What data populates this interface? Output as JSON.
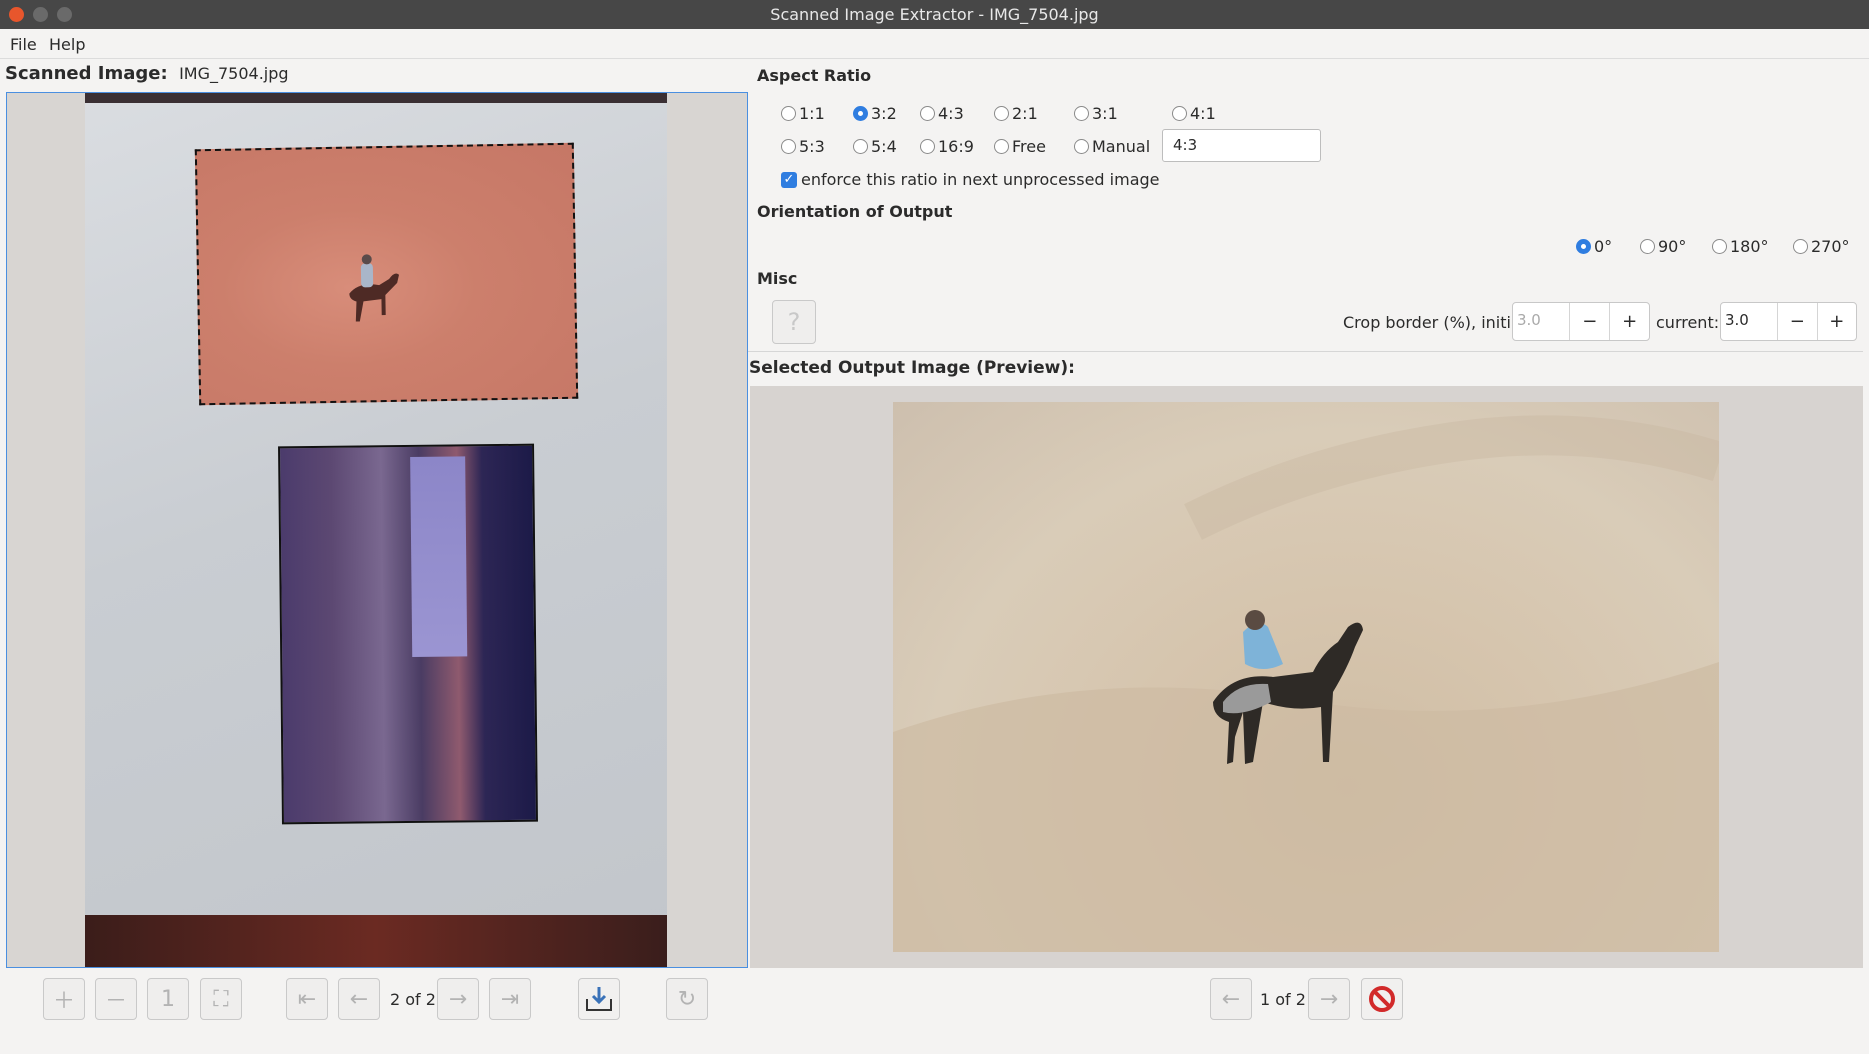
{
  "window": {
    "title": "Scanned Image Extractor - IMG_7504.jpg"
  },
  "menu": {
    "file": "File",
    "help": "Help"
  },
  "left": {
    "label": "Scanned Image:",
    "filename": "IMG_7504.jpg",
    "nav_counter": "2 of 2"
  },
  "aspect": {
    "title": "Aspect Ratio",
    "options": [
      "1:1",
      "3:2",
      "4:3",
      "2:1",
      "3:1",
      "4:1",
      "5:3",
      "5:4",
      "16:9",
      "Free",
      "Manual"
    ],
    "selected": "3:2",
    "manual_value": "4:3",
    "enforce_label": "enforce this ratio in next unprocessed image",
    "enforce_checked": true
  },
  "orientation": {
    "title": "Orientation of Output",
    "options": [
      "0°",
      "90°",
      "180°",
      "270°"
    ],
    "selected": "0°"
  },
  "misc": {
    "title": "Misc",
    "help_button": "?",
    "crop_initial_label": "Crop border (%), initial:",
    "crop_initial_value": "3.0",
    "crop_current_label": "current:",
    "crop_current_value": "3.0",
    "minus": "−",
    "plus": "+"
  },
  "preview": {
    "title": "Selected Output Image (Preview):",
    "nav_counter": "1 of 2"
  },
  "colors": {
    "accent": "#2f7de0",
    "titlebar": "#474747",
    "window_bg": "#f4f3f2"
  },
  "icons": {
    "left_toolbar": [
      "zoom-in-icon",
      "zoom-out-icon",
      "zoom-100-icon",
      "fit-to-window-icon",
      "first-icon",
      "previous-icon",
      "next-icon",
      "last-icon",
      "save-icon",
      "rotate-icon"
    ],
    "right_toolbar": [
      "previous-icon",
      "next-icon",
      "delete-icon"
    ]
  }
}
